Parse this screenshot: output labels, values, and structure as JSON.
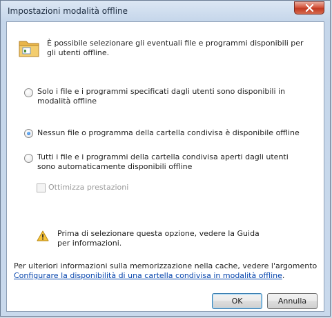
{
  "window": {
    "title": "Impostazioni modalità offline"
  },
  "intro_text": "È possibile selezionare gli eventuali file e programmi disponibili per gli utenti offline.",
  "options": [
    {
      "label": "Solo i file e i programmi specificati dagli utenti sono disponibili in modalità offline",
      "checked": false
    },
    {
      "label": "Nessun file o programma della cartella condivisa è disponibile offline",
      "checked": true
    },
    {
      "label": "Tutti i file e i programmi della cartella condivisa aperti dagli utenti sono automaticamente disponibili offline",
      "checked": false
    }
  ],
  "optimize_checkbox": {
    "label": "Ottimizza prestazioni",
    "checked": false,
    "enabled": false
  },
  "warning_text": "Prima di selezionare questa opzione, vedere la Guida per informazioni.",
  "footer": {
    "text": "Per ulteriori informazioni sulla memorizzazione nella cache, vedere l'argomento",
    "link": "Configurare la disponibilità di una cartella condivisa in modalità offline",
    "link_suffix": "."
  },
  "buttons": {
    "ok": "OK",
    "cancel": "Annulla"
  },
  "icons": {
    "close": "close-icon",
    "folder": "folder-icon",
    "warning": "warning-icon"
  },
  "colors": {
    "link": "#0645ad",
    "close_button": "#c9452d",
    "title_bar": "#c5d6ea"
  }
}
